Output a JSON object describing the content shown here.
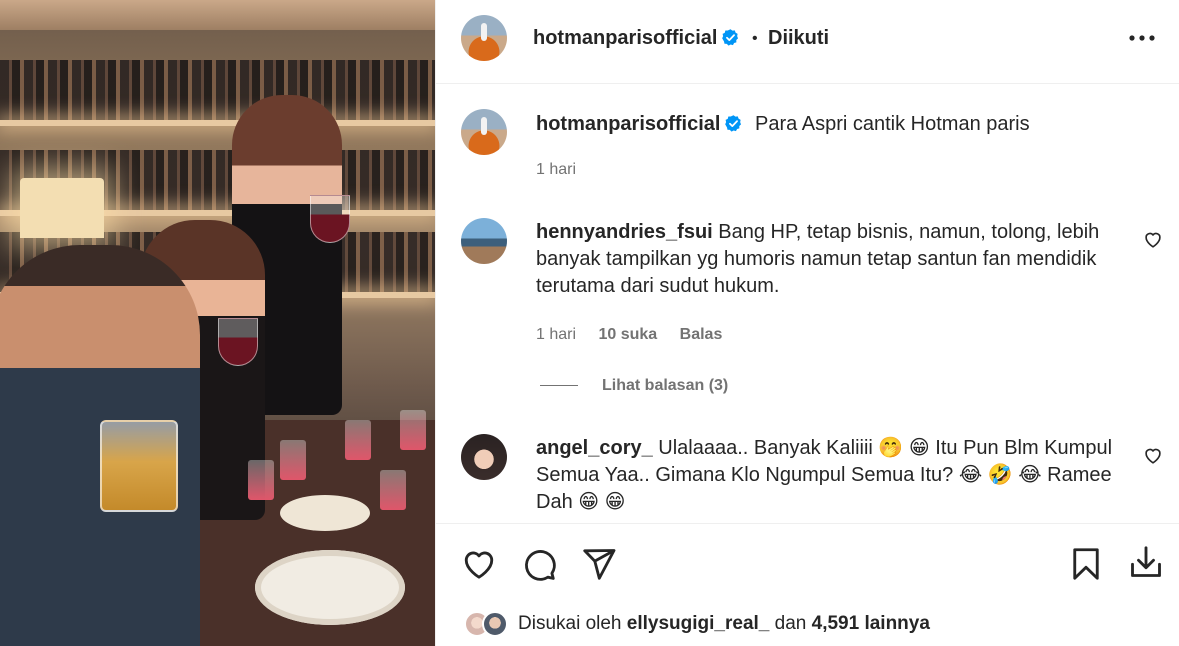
{
  "header": {
    "username": "hotmanparisofficial",
    "separator": "•",
    "follow_status": "Diikuti",
    "more_icon": "more-horizontal-icon"
  },
  "caption": {
    "username": "hotmanparisofficial",
    "text": "Para Aspri cantik Hotman paris",
    "time": "1 hari"
  },
  "comments": [
    {
      "username": "hennyandries_fsui",
      "text": "Bang HP, tetap bisnis, namun, tolong, lebih banyak tampilkan yg humoris namun tetap santun fan mendidik terutama dari sudut hukum.",
      "time": "1 hari",
      "likes": "10 suka",
      "reply_label": "Balas",
      "view_replies": "Lihat balasan (3)"
    },
    {
      "username": "angel_cory_",
      "text": "Ulalaaaa.. Banyak Kaliiii 🤭 😁  Itu Pun Blm Kumpul Semua Yaa.. Gimana Klo Ngumpul Semua Itu? 😂 🤣 😂  Ramee Dah 😁 😁"
    }
  ],
  "likes": {
    "prefix": "Disukai oleh",
    "user": "ellysugigi_real_",
    "middle": "dan",
    "count": "4,591 lainnya"
  },
  "colors": {
    "text": "#262626",
    "secondary": "#737373",
    "verified": "#0095f6",
    "divider": "#efefef"
  },
  "icons": [
    "verified-badge-icon",
    "heart-icon",
    "comment-icon",
    "share-icon",
    "bookmark-icon",
    "download-icon"
  ]
}
